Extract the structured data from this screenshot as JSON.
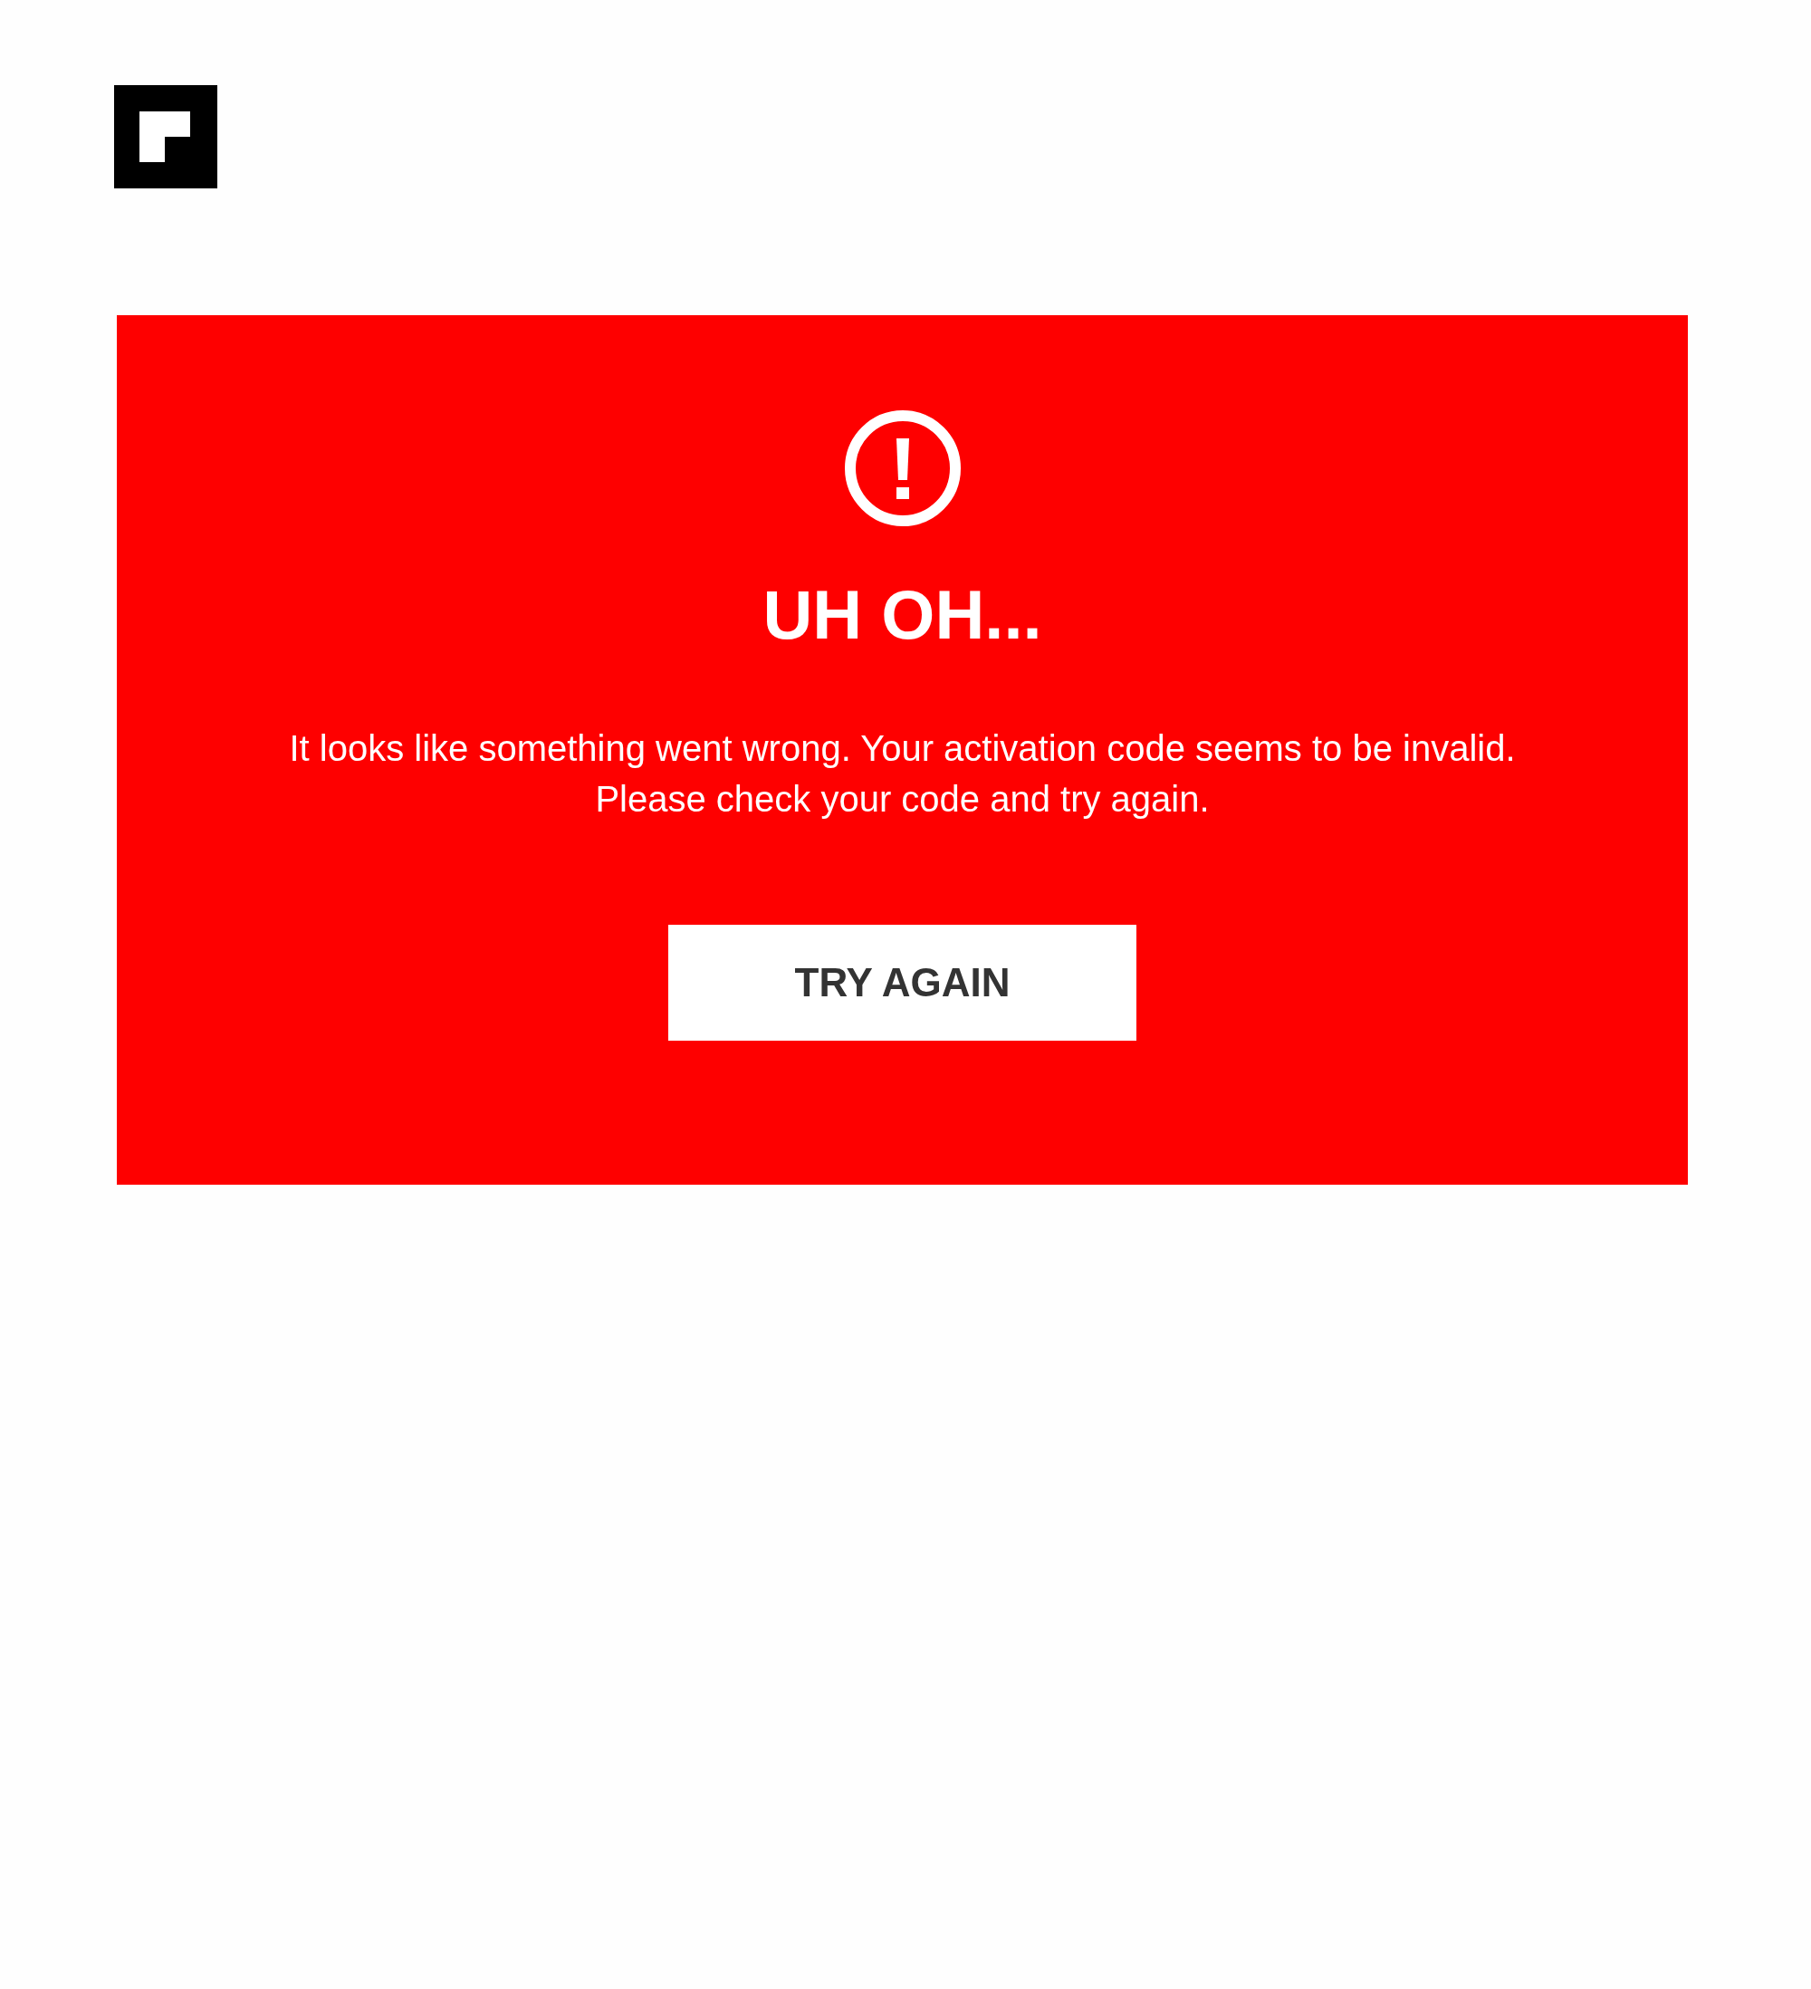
{
  "alert": {
    "title": "UH OH...",
    "message": "It looks like something went wrong. Your activation code seems to be invalid.\nPlease check your code and try again."
  },
  "buttons": [
    {
      "label": "TRY AGAIN"
    }
  ]
}
